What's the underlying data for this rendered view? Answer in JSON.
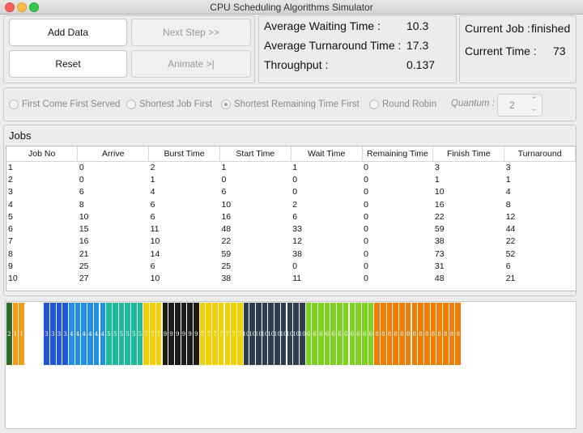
{
  "window": {
    "title": "CPU Scheduling Algorithms Simulator"
  },
  "buttons": {
    "add_data": "Add Data",
    "next_step": "Next Step >>",
    "reset": "Reset",
    "animate": "Animate >|"
  },
  "stats": {
    "avg_waiting_label": "Average Waiting Time :",
    "avg_waiting_value": "10.3",
    "avg_turnaround_label": "Average Turnaround Time :",
    "avg_turnaround_value": "17.3",
    "throughput_label": "Throughput :",
    "throughput_value": "0.137"
  },
  "status": {
    "current_job_label": "Current Job :",
    "current_job_value": "finished",
    "current_time_label": "Current Time :",
    "current_time_value": "73"
  },
  "algorithms": {
    "fcfs": "First Come First Served",
    "sjf": "Shortest Job First",
    "srtf": "Shortest Remaining Time First",
    "rr": "Round Robin",
    "selected": "Shortest Remaining Time First",
    "quantum_label": "Quantum :",
    "quantum_value": "2"
  },
  "jobs": {
    "title": "Jobs",
    "columns": [
      "Job No",
      "Arrive",
      "Burst Time",
      "Start Time",
      "Wait Time",
      "Remaining Time",
      "Finish Time",
      "Turnaround"
    ],
    "rows": [
      [
        "1",
        "0",
        "2",
        "1",
        "1",
        "0",
        "3",
        "3"
      ],
      [
        "2",
        "0",
        "1",
        "0",
        "0",
        "0",
        "1",
        "1"
      ],
      [
        "3",
        "6",
        "4",
        "6",
        "0",
        "0",
        "10",
        "4"
      ],
      [
        "4",
        "8",
        "6",
        "10",
        "2",
        "0",
        "16",
        "8"
      ],
      [
        "5",
        "10",
        "6",
        "16",
        "6",
        "0",
        "22",
        "12"
      ],
      [
        "6",
        "15",
        "11",
        "48",
        "33",
        "0",
        "59",
        "44"
      ],
      [
        "7",
        "16",
        "10",
        "22",
        "12",
        "0",
        "38",
        "22"
      ],
      [
        "8",
        "21",
        "14",
        "59",
        "38",
        "0",
        "73",
        "52"
      ],
      [
        "9",
        "25",
        "6",
        "25",
        "0",
        "0",
        "31",
        "6"
      ],
      [
        "10",
        "27",
        "10",
        "38",
        "11",
        "0",
        "48",
        "21"
      ]
    ]
  },
  "gantt": {
    "colors": {
      "1": "#f39c12",
      "2": "#2d6e2d",
      "3": "#2255dd",
      "4": "#1e90e8",
      "5": "#1abc9c",
      "6": "#7ed321",
      "7": "#f5d000",
      "8": "#f57c00",
      "9": "#1a1a1a",
      "10": "#2c3e50",
      "idle": "#ffffff"
    },
    "sequence": [
      "2",
      "1",
      "1",
      "idle",
      "idle",
      "idle",
      "3",
      "3",
      "3",
      "3",
      "4",
      "4",
      "4",
      "4",
      "4",
      "4",
      "5",
      "5",
      "5",
      "5",
      "5",
      "5",
      "7",
      "7",
      "7",
      "9",
      "9",
      "9",
      "9",
      "9",
      "9",
      "7",
      "7",
      "7",
      "7",
      "7",
      "7",
      "7",
      "10",
      "10",
      "10",
      "10",
      "10",
      "10",
      "10",
      "10",
      "10",
      "10",
      "6",
      "6",
      "6",
      "6",
      "6",
      "6",
      "6",
      "6",
      "6",
      "6",
      "6",
      "8",
      "8",
      "8",
      "8",
      "8",
      "8",
      "8",
      "8",
      "8",
      "8",
      "8",
      "8",
      "8",
      "8"
    ]
  }
}
